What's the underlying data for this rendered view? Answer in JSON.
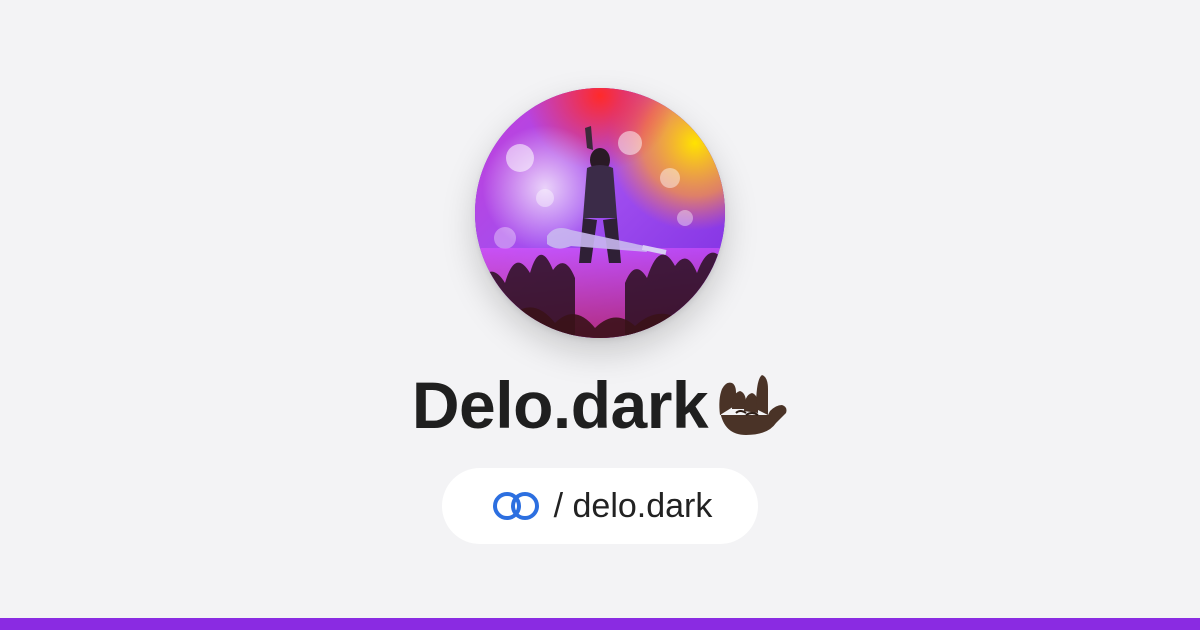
{
  "profile": {
    "display_name": "Delo.dark",
    "title_emoji": "love-you-gesture-emoji",
    "link_prefix": "/ delo.dark",
    "avatar": "concert-guitarist-photo"
  },
  "icons": {
    "link": "link-icon"
  },
  "colors": {
    "background": "#f3f3f5",
    "accent_bar": "#8a2be2",
    "link_icon": "#2c6fe0",
    "title_text": "#1f1f1f"
  }
}
